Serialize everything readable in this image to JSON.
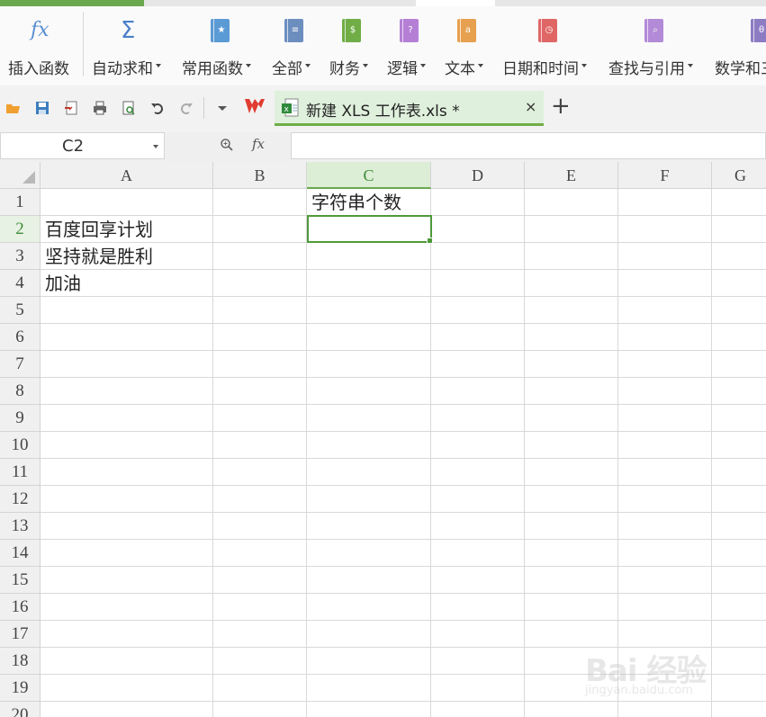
{
  "ribbon": {
    "insert_function": "插入函数",
    "autosum": "自动求和",
    "common_functions": "常用函数",
    "all": "全部",
    "finance": "财务",
    "logic": "逻辑",
    "text": "文本",
    "datetime": "日期和时间",
    "lookup": "查找与引用",
    "math": "数学和三角",
    "fx_glyph": "fx",
    "sigma_glyph": "Σ"
  },
  "document": {
    "tab_title": "新建 XLS 工作表.xls *",
    "close_glyph": "×",
    "new_tab_glyph": "+"
  },
  "formula_bar": {
    "name_box": "C2",
    "fx_label": "fx",
    "formula": ""
  },
  "sheet": {
    "columns": [
      "A",
      "B",
      "C",
      "D",
      "E",
      "F",
      "G"
    ],
    "rows": [
      "1",
      "2",
      "3",
      "4",
      "5",
      "6",
      "7",
      "8",
      "9",
      "10",
      "11",
      "12",
      "13",
      "14",
      "15",
      "16",
      "17",
      "18",
      "19",
      "20"
    ],
    "selected_cell": "C2",
    "cells": {
      "C1": "字符串个数",
      "A2": "百度回享计划",
      "A3": "坚持就是胜利",
      "A4": "加油"
    }
  },
  "watermark": {
    "line1": "Bai 经验",
    "line2": "jingyan.baidu.com"
  },
  "colors": {
    "accent_green": "#6aa84f",
    "selected_header_bg": "#dceed6",
    "doc_tab_bg": "#dff0dc"
  },
  "icons": {
    "finance_book": "#6fa8dc",
    "common_book": "#5b9bd5",
    "all_book": "#6c8ebf",
    "finance": "#70ad47",
    "logic": "#b57fd6",
    "text": "#e6a04f",
    "datetime": "#e06666",
    "lookup": "#b38ad8",
    "math": "#8e7cc3"
  }
}
